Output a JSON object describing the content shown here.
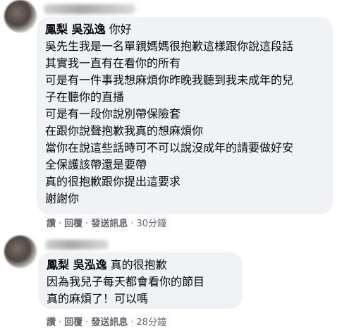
{
  "comments": [
    {
      "mention_name": "鳳梨 吳泓逸",
      "first_text": "你好",
      "lines": [
        "吳先生我是一名單親媽媽很抱歉這樣跟你說這段話",
        "其實我一直有在看你的所有",
        "可是有一件事我想麻煩你昨晚我聽到我未成年的兒",
        "子在聽你的直播",
        "可是有一段你說別帶保險套",
        "在跟你說聲抱歉我真的想麻煩你",
        "當你在說這些話時可不可以說沒成年的請要做好安",
        "全保護該帶還是要帶",
        "真的很抱歉跟你提出這要求",
        "謝謝你"
      ],
      "actions": {
        "like": "讚",
        "reply": "回覆",
        "message": "發送訊息",
        "time": "30分鐘"
      }
    },
    {
      "mention_name": "鳳梨 吳泓逸",
      "first_text": "真的很抱歉",
      "lines": [
        "因為我兒子每天都會看你的節目",
        "真的麻煩了！可以嗎"
      ],
      "actions": {
        "like": "讚",
        "reply": "回覆",
        "message": "發送訊息",
        "time": "28分鐘"
      }
    }
  ]
}
